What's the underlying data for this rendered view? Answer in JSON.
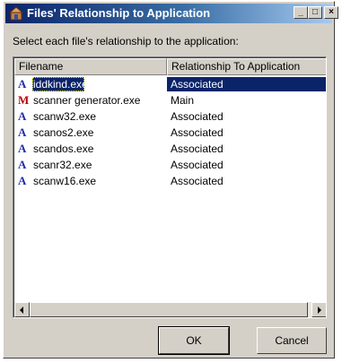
{
  "window": {
    "title": "Files' Relationship to Application",
    "icon": "application-icon",
    "controls": {
      "minimize": "_",
      "maximize": "□",
      "close": "×"
    }
  },
  "instruction": "Select each file's relationship to the application:",
  "list": {
    "columns": [
      "Filename",
      "Relationship To Application"
    ],
    "rows": [
      {
        "icon": "A",
        "filename": "iddkind.exe",
        "relationship": "Associated",
        "selected": true
      },
      {
        "icon": "M",
        "filename": "scanner generator.exe",
        "relationship": "Main",
        "selected": false
      },
      {
        "icon": "A",
        "filename": "scanw32.exe",
        "relationship": "Associated",
        "selected": false
      },
      {
        "icon": "A",
        "filename": "scanos2.exe",
        "relationship": "Associated",
        "selected": false
      },
      {
        "icon": "A",
        "filename": "scandos.exe",
        "relationship": "Associated",
        "selected": false
      },
      {
        "icon": "A",
        "filename": "scanr32.exe",
        "relationship": "Associated",
        "selected": false
      },
      {
        "icon": "A",
        "filename": "scanw16.exe",
        "relationship": "Associated",
        "selected": false
      }
    ]
  },
  "buttons": {
    "ok": "OK",
    "cancel": "Cancel"
  },
  "colors": {
    "title_bar": "#0a246a",
    "selection": "#0a246a",
    "associated_icon": "#1f2fa8",
    "main_icon": "#c00000"
  }
}
